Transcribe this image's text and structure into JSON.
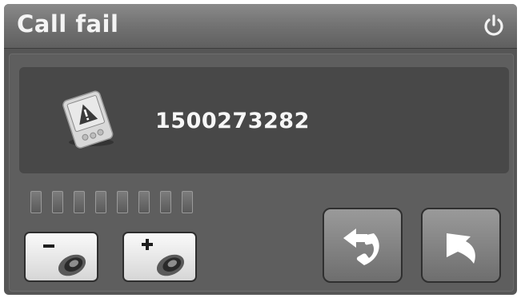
{
  "title_bar": {
    "title": "Call fail",
    "power_icon": "power-icon"
  },
  "call_info": {
    "icon": "pda-warning-icon",
    "number": "1500273282"
  },
  "signal": {
    "bar_count": 8
  },
  "controls": {
    "volume_down_icon": "volume-down-icon",
    "volume_up_icon": "volume-up-icon",
    "redial_icon": "redial-icon",
    "back_icon": "back-arrow-icon"
  }
}
